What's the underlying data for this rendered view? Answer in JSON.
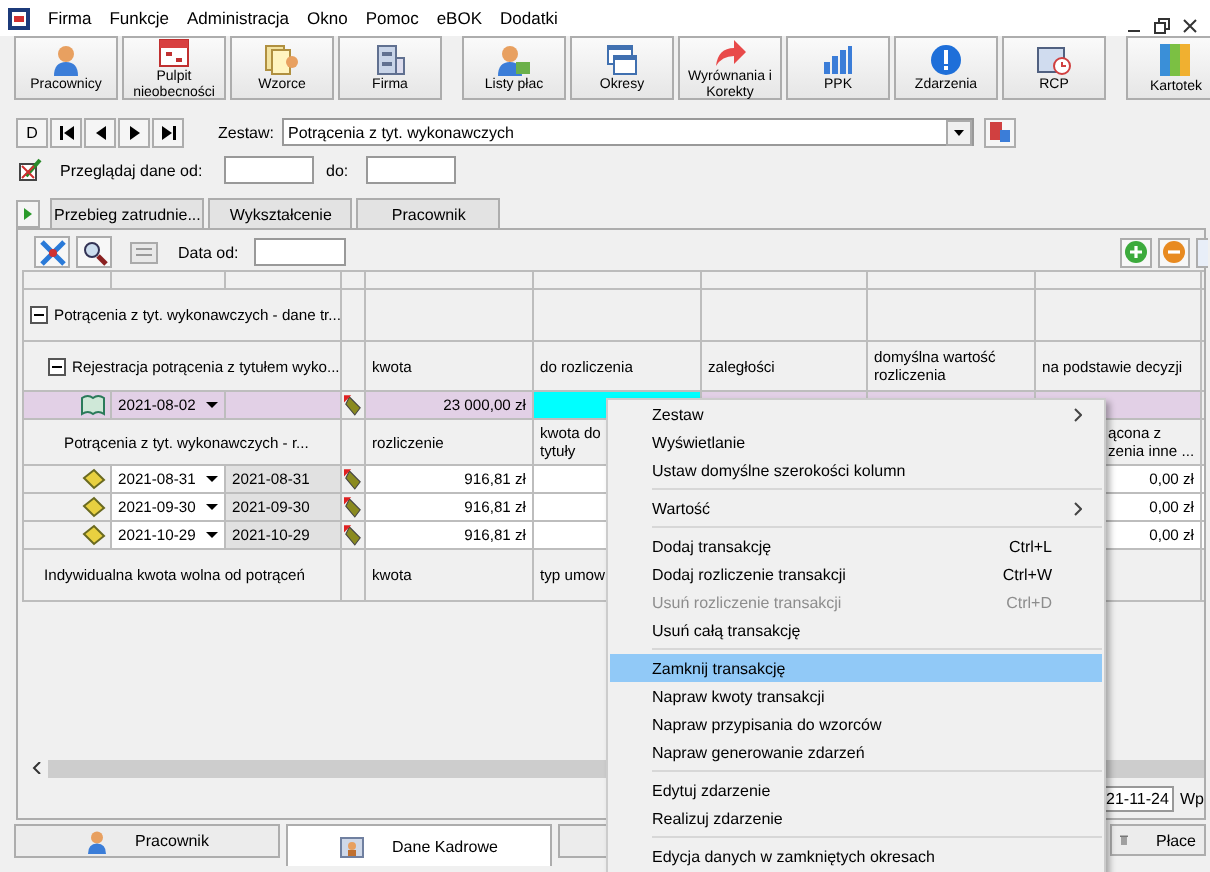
{
  "menu_bar": [
    "Firma",
    "Funkcje",
    "Administracja",
    "Okno",
    "Pomoc",
    "eBOK",
    "Dodatki"
  ],
  "toolbar": [
    [
      "Pracownicy",
      "Pulpit nieobecności",
      "Wzorce",
      "Firma"
    ],
    [
      "Listy płac",
      "Okresy",
      "Wyrównania i Korekty",
      "PPK",
      "Zdarzenia",
      "RCP"
    ],
    [
      "Kartotek"
    ]
  ],
  "nav_buttons": [
    {
      "kind": "text",
      "label": "D"
    },
    {
      "kind": "first"
    },
    {
      "kind": "prev"
    },
    {
      "kind": "next"
    },
    {
      "kind": "last"
    }
  ],
  "zestaw": {
    "label": "Zestaw:",
    "value": "Potrącenia z tyt. wykonawczych"
  },
  "filter": {
    "label": "Przeglądaj dane od:",
    "to_label": "do:"
  },
  "tabs": [
    {
      "label": "Przebieg zatrudnie...",
      "selected": false
    },
    {
      "label": "Wykształcenie",
      "selected": false
    },
    {
      "label": "Pracownik",
      "selected": false
    }
  ],
  "panel_toolbar": {
    "date_label": "Data od:"
  },
  "grid": {
    "group_row": {
      "label": "Potrącenia z tyt. wykonawczych - dane tr...",
      "expanded": true
    },
    "header": {
      "label": "Rejestracja potrącenia z tytułem wyko...",
      "expanded": true,
      "columns": [
        "kwota",
        "do rozliczenia",
        "zaległości",
        "domyślna wartość rozliczenia",
        "na podstawie decyzji"
      ]
    },
    "transaction": {
      "date": "2021-08-02",
      "kwota": "23 000,00 zł",
      "selected": true
    },
    "sub_header": {
      "label": "Potrącenia z tyt. wykonawczych - r...",
      "rozliczenie": "rozliczenie",
      "kwota_do": "kwota do tytuły",
      "column_5": "ącona z zenia inne ..."
    },
    "settlements": [
      {
        "date": "2021-08-31",
        "end_date": "2021-08-31",
        "rozliczenie": "916,81 zł",
        "column_5": "0,00 zł"
      },
      {
        "date": "2021-09-30",
        "end_date": "2021-09-30",
        "rozliczenie": "916,81 zł",
        "column_5": "0,00 zł"
      },
      {
        "date": "2021-10-29",
        "end_date": "2021-10-29",
        "rozliczenie": "916,81 zł",
        "column_5": "0,00 zł"
      }
    ],
    "footer_row": {
      "label": "Indywidualna kwota wolna od potrąceń",
      "kwota": "kwota",
      "column_2": "typ umow"
    }
  },
  "status": {
    "date_field": "21-11-24",
    "label": "Wp"
  },
  "bottom_tabs": [
    {
      "label": "Pracownik",
      "selected": false
    },
    {
      "label": "Dane Kadrowe",
      "selected": true
    },
    {
      "selected": false
    }
  ],
  "side_button": "Płace",
  "context_menu": [
    [
      {
        "label": "Zestaw",
        "submenu": true,
        "disabled": false,
        "selected": false
      },
      {
        "label": "Wyświetlanie",
        "submenu": false,
        "disabled": false,
        "selected": false
      },
      {
        "label": "Ustaw domyślne szerokości kolumn",
        "submenu": false,
        "disabled": false,
        "selected": false
      }
    ],
    [
      {
        "label": "Wartość",
        "submenu": true,
        "disabled": false,
        "selected": false
      }
    ],
    [
      {
        "label": "Dodaj transakcję",
        "shortcut": "Ctrl+L",
        "submenu": false,
        "disabled": false,
        "selected": false
      },
      {
        "label": "Dodaj rozliczenie transakcji",
        "shortcut": "Ctrl+W",
        "submenu": false,
        "disabled": false,
        "selected": false
      },
      {
        "label": "Usuń rozliczenie transakcji",
        "shortcut": "Ctrl+D",
        "submenu": false,
        "disabled": true,
        "selected": false
      },
      {
        "label": "Usuń całą transakcję",
        "submenu": false,
        "disabled": false,
        "selected": false
      }
    ],
    [
      {
        "label": "Zamknij transakcję",
        "submenu": false,
        "disabled": false,
        "selected": true
      },
      {
        "label": "Napraw kwoty transakcji",
        "submenu": false,
        "disabled": false,
        "selected": false
      },
      {
        "label": "Napraw przypisania do wzorców",
        "submenu": false,
        "disabled": false,
        "selected": false
      },
      {
        "label": "Napraw generowanie zdarzeń",
        "submenu": false,
        "disabled": false,
        "selected": false
      }
    ],
    [
      {
        "label": "Edytuj zdarzenie",
        "submenu": false,
        "disabled": false,
        "selected": false
      },
      {
        "label": "Realizuj zdarzenie",
        "submenu": false,
        "disabled": false,
        "selected": false
      }
    ],
    [
      {
        "label": "Edycja danych w zamkniętych okresach",
        "submenu": false,
        "disabled": false,
        "selected": false
      }
    ]
  ]
}
